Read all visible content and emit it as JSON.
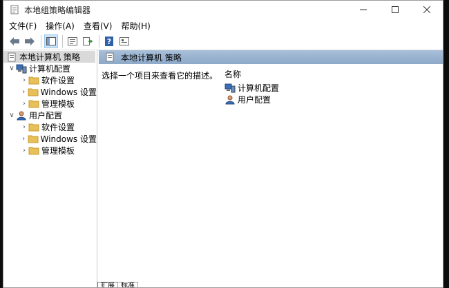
{
  "window": {
    "title": "本地组策略编辑器"
  },
  "menubar": {
    "items": [
      "文件(F)",
      "操作(A)",
      "查看(V)",
      "帮助(H)"
    ]
  },
  "tree": {
    "root": "本地计算机 策略",
    "computer": {
      "label": "计算机配置",
      "children": [
        "软件设置",
        "Windows 设置",
        "管理模板"
      ]
    },
    "user": {
      "label": "用户配置",
      "children": [
        "软件设置",
        "Windows 设置",
        "管理模板"
      ]
    }
  },
  "detail": {
    "header": "本地计算机 策略",
    "description": "选择一个项目来查看它的描述。",
    "column_name": "名称",
    "items": [
      "计算机配置",
      "用户配置"
    ]
  },
  "tabs": [
    "扩展",
    "标准"
  ],
  "colors": {
    "header_gradient_top": "#a7bfd9",
    "header_gradient_bottom": "#8ea8c8",
    "folder": "#e8c05a",
    "tree_selected": "#d9d9d9"
  }
}
